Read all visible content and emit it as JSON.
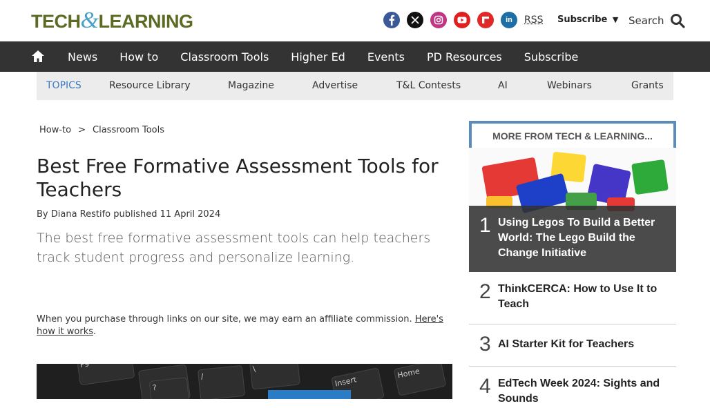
{
  "header": {
    "logo_part1": "TECH",
    "logo_amp": "&",
    "logo_part2": "LEARNING",
    "socials": [
      "facebook-icon",
      "x-icon",
      "instagram-icon",
      "youtube-icon",
      "flipboard-icon",
      "linkedin-icon"
    ],
    "rss_label": "RSS",
    "subscribe_label": "Subscribe",
    "search_label": "Search"
  },
  "nav": {
    "items": [
      "News",
      "How to",
      "Classroom Tools",
      "Higher Ed",
      "Events",
      "PD Resources",
      "Subscribe"
    ]
  },
  "topics": {
    "items": [
      "TOPICS",
      "Resource Library",
      "Magazine",
      "Advertise",
      "T&L Contests",
      "AI",
      "Webinars",
      "Grants"
    ]
  },
  "article": {
    "breadcrumb": [
      "How-to",
      "Classroom Tools"
    ],
    "breadcrumb_sep": ">",
    "title": "Best Free Formative Assessment Tools for Teachers",
    "byline": "By Diana Restifo published 11 April 2024",
    "dek": "The best free formative assessment tools can help teachers track student progress and personalize learning.",
    "affiliate_text": "When you purchase through links on our site, we may earn an affiliate commission. ",
    "affiliate_link": "Here's how it works",
    "affiliate_end": "."
  },
  "hero_keys": [
    "F9",
    "?",
    "/",
    "\\",
    "Insert",
    "Home"
  ],
  "sidebar": {
    "heading": "MORE FROM TECH & LEARNING...",
    "items": [
      {
        "rank": "1",
        "title": "Using Legos To Build a Better World: The Lego Build the Change Initiative"
      },
      {
        "rank": "2",
        "title": "ThinkCERCA: How to Use It to Teach"
      },
      {
        "rank": "3",
        "title": "AI Starter Kit for Teachers"
      },
      {
        "rank": "4",
        "title": "EdTech Week 2024: Sights and Sounds"
      }
    ]
  },
  "colors": {
    "logo_green": "#5b6b24",
    "logo_blue": "#4aa0c9",
    "nav_bg": "#333333",
    "topics_bg": "#ececec",
    "topics_accent": "#3b7bbf",
    "sidebar_border": "#5b8bb8"
  }
}
